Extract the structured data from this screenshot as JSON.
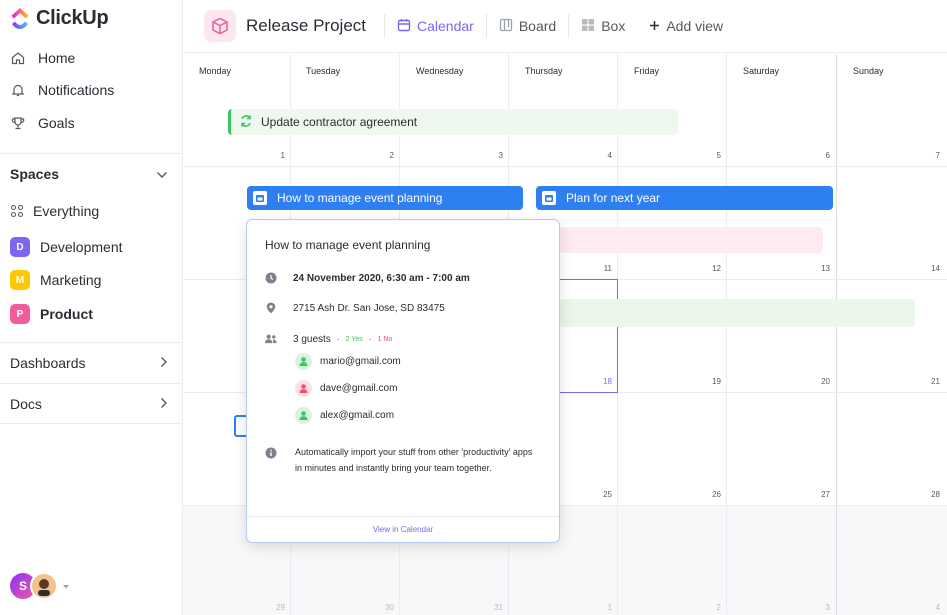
{
  "app": {
    "name": "ClickUp"
  },
  "sidebar": {
    "nav": [
      {
        "label": "Home",
        "icon": "home-icon"
      },
      {
        "label": "Notifications",
        "icon": "bell-icon"
      },
      {
        "label": "Goals",
        "icon": "trophy-icon"
      }
    ],
    "spaces_label": "Spaces",
    "everything_label": "Everything",
    "spaces": [
      {
        "letter": "D",
        "label": "Development",
        "color": "#7b68ee"
      },
      {
        "letter": "M",
        "label": "Marketing",
        "color": "#ffc800"
      },
      {
        "letter": "P",
        "label": "Product",
        "color": "#f15c9e"
      }
    ],
    "dashboards_label": "Dashboards",
    "docs_label": "Docs",
    "avatar_letter": "S"
  },
  "header": {
    "project_title": "Release Project",
    "views": [
      {
        "label": "Calendar",
        "icon": "calendar-icon",
        "active": true
      },
      {
        "label": "Board",
        "icon": "board-icon",
        "active": false
      },
      {
        "label": "Box",
        "icon": "box-icon",
        "active": false
      }
    ],
    "add_view_label": "Add view"
  },
  "calendar": {
    "days": [
      "Monday",
      "Tuesday",
      "Wednesday",
      "Thursday",
      "Friday",
      "Saturday",
      "Sunday"
    ],
    "week1": [
      "1",
      "2",
      "3",
      "4",
      "5",
      "6",
      "7"
    ],
    "week2": [
      "11",
      "12",
      "13",
      "14"
    ],
    "week3": [
      "18",
      "19",
      "20",
      "21"
    ],
    "week4": [
      "25",
      "26",
      "27",
      "28"
    ],
    "week5": [
      "29",
      "30",
      "31",
      "1",
      "2",
      "3",
      "4"
    ],
    "events": {
      "contractor": "Update contractor agreement",
      "event_planning": "How to manage event planning",
      "next_year": "Plan for next year"
    }
  },
  "popup": {
    "title": "How to manage event planning",
    "datetime": "24 November 2020, 6:30 am - 7:00 am",
    "address": "2715 Ash Dr. San Jose, SD 83475",
    "guests_label": "3 guests",
    "yes_label": "2 Yes",
    "no_label": "1 No",
    "guests": [
      {
        "email": "mario@gmail.com",
        "status": "yes"
      },
      {
        "email": "dave@gmail.com",
        "status": "no"
      },
      {
        "email": "alex@gmail.com",
        "status": "yes"
      }
    ],
    "description": "Automatically import your stuff from other 'productivity' apps in minutes and instantly bring your team together.",
    "footer_link": "View in Calendar"
  },
  "colors": {
    "accent": "#7b68ee",
    "event_blue": "#2e7ff1",
    "event_green": "#3dc564",
    "yes_green": "#3dc564",
    "no_red": "#f0506e"
  }
}
